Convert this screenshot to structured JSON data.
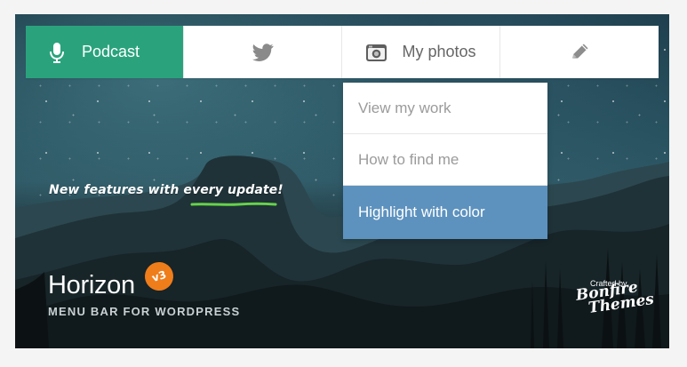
{
  "menu": {
    "items": [
      {
        "label": "Podcast",
        "icon": "microphone-icon"
      },
      {
        "label": "",
        "icon": "twitter-icon"
      },
      {
        "label": "My photos",
        "icon": "camera-icon"
      },
      {
        "label": "",
        "icon": "pencil-icon"
      }
    ]
  },
  "dropdown": {
    "items": [
      "View my work",
      "How to find me",
      "Highlight with color"
    ]
  },
  "hero": {
    "tagline": "New features with every update!",
    "title": "Horizon",
    "version": "v3",
    "subtitle": "MENU BAR FOR WORDPRESS",
    "credit_small": "Crafted by",
    "credit_brand_line1": "Bonfire",
    "credit_brand_line2": "Themes"
  },
  "colors": {
    "active_menu": "#2aa37d",
    "dropdown_highlight": "#5d92bf",
    "version_badge": "#ef7d1a",
    "tagline_underline": "#67d24a"
  }
}
